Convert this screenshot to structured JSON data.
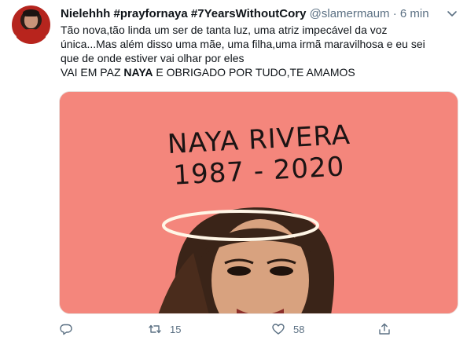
{
  "tweet": {
    "display_name": "Nielehhh #prayfornaya #7YearsWithoutCory",
    "handle": "@slamermaum",
    "separator": "·",
    "time": "6 min",
    "text_line1": "Tão nova,tão linda um ser de tanta luz, uma atriz impecável da voz",
    "text_line2": "única...Mas além disso uma mãe, uma filha,uma irmã maravilhosa e eu sei",
    "text_line3": "que de onde estiver vai olhar por eles",
    "text_line4_before": "VAI EM PAZ ",
    "text_line4_bold": "NAYA",
    "text_line4_after": " E OBRIGADO POR TUDO,TE AMAMOS",
    "media": {
      "headline": "NAYA RIVERA",
      "years": "1987 - 2020",
      "background_color": "#f4867c"
    },
    "actions": {
      "reply_icon": "reply-icon",
      "retweet_icon": "retweet-icon",
      "retweet_count": "15",
      "like_icon": "heart-icon",
      "like_count": "58",
      "share_icon": "share-icon"
    }
  }
}
